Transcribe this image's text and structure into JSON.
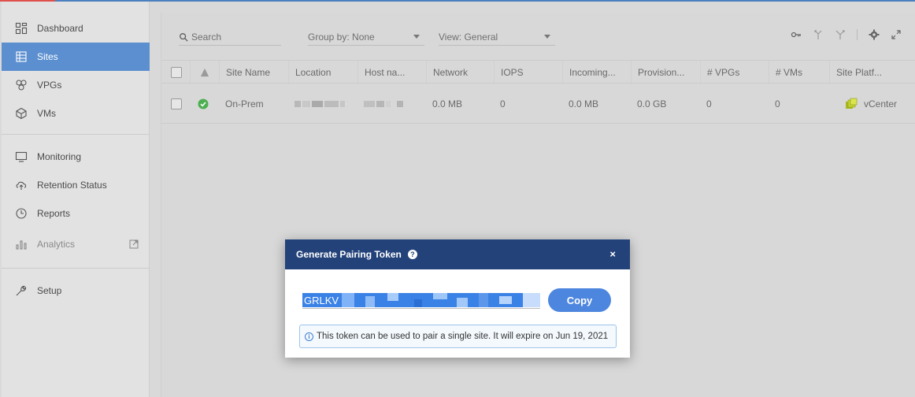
{
  "sidebar": {
    "items": [
      {
        "label": "Dashboard",
        "icon": "dashboard-icon"
      },
      {
        "label": "Sites",
        "icon": "sites-icon",
        "active": true
      },
      {
        "label": "VPGs",
        "icon": "vpgs-icon"
      },
      {
        "label": "VMs",
        "icon": "vms-icon"
      },
      {
        "label": "Monitoring",
        "icon": "monitor-icon"
      },
      {
        "label": "Retention Status",
        "icon": "cloud-upload-icon"
      },
      {
        "label": "Reports",
        "icon": "clock-icon"
      },
      {
        "label": "Analytics",
        "icon": "analytics-icon",
        "disabled": true
      },
      {
        "label": "Setup",
        "icon": "wrench-icon"
      }
    ]
  },
  "toolbar": {
    "search_placeholder": "Search",
    "group_by": "Group by: None",
    "view": "View: General"
  },
  "table": {
    "columns": [
      "Site Name",
      "Location",
      "Host na...",
      "Network",
      "IOPS",
      "Incoming...",
      "Provision...",
      "# VPGs",
      "# VMs",
      "Site Platf..."
    ],
    "rows": [
      {
        "status": "ok",
        "site_name": "On-Prem",
        "network": "0.0 MB",
        "iops": "0",
        "incoming": "0.0 MB",
        "provisioned": "0.0 GB",
        "vpgs": "0",
        "vms": "0",
        "platform": "vCenter"
      }
    ]
  },
  "modal": {
    "title": "Generate Pairing Token",
    "close": "×",
    "token_prefix": "GRLKV",
    "copy_label": "Copy",
    "note": "This token can be used to pair a single site. It will expire on Jun 19, 2021"
  },
  "colors": {
    "accent": "#5b8fcf",
    "modal_header": "#23427a",
    "button": "#4d86df",
    "ok": "#4caf50"
  }
}
